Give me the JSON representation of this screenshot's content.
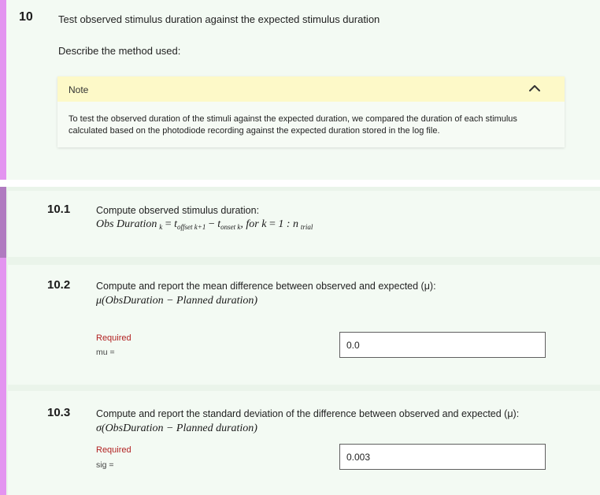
{
  "section10": {
    "number": "10",
    "title": "Test observed stimulus duration against the expected stimulus duration",
    "describe_label": "Describe the method used:",
    "note": {
      "label": "Note",
      "icon": "chevron-up-icon",
      "body": "To test the observed duration of the stimuli against the expected duration, we compared the duration of each stimulus calculated based on the photodiode recording against the expected duration stored in the log file."
    }
  },
  "subsections": [
    {
      "number": "10.1",
      "title": "Compute observed stimulus duration:",
      "formula": {
        "lhs": "Obs Duration",
        "lhs_sub": "k",
        "eq": "=",
        "t1": "t",
        "t1_sub": "offset k+1",
        "minus": "−",
        "t2": "t",
        "t2_sub": "onset k",
        "for_text": ",  for k",
        "eq2": "=",
        "range": "1 : n",
        "range_sub": "trial"
      }
    },
    {
      "number": "10.2",
      "title": "Compute and report the mean difference between observed and expected (μ):",
      "formula": "μ(ObsDuration − Planned duration)",
      "required_label": "Required",
      "var_label": "mu =",
      "value": "0.0"
    },
    {
      "number": "10.3",
      "title": "Compute and report the standard deviation of the difference between observed and expected (μ):",
      "formula": "σ(ObsDuration − Planned duration)",
      "required_label": "Required",
      "var_label": "sig =",
      "value": "0.003"
    }
  ],
  "colors": {
    "accent_bar": "#e394f0",
    "accent_bar_dark": "#b07ac0",
    "note_header": "#fdf9c8",
    "required": "#b22222",
    "section_bg": "#f3faf3"
  }
}
